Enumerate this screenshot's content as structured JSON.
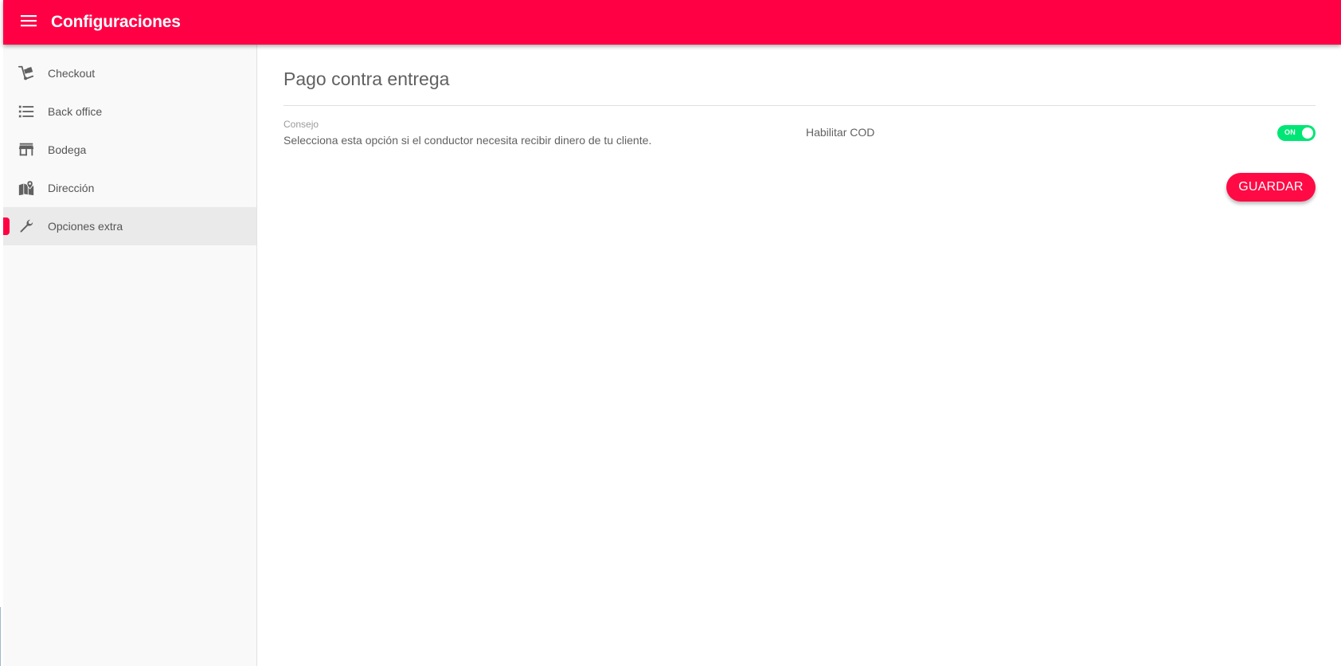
{
  "app_bar": {
    "title": "Configuraciones",
    "menu_icon": "menu-icon",
    "color": "#ff0045"
  },
  "sidebar": {
    "items": [
      {
        "label": "Checkout",
        "icon": "hand-truck-icon",
        "active": false
      },
      {
        "label": "Back office",
        "icon": "list-icon",
        "active": false
      },
      {
        "label": "Bodega",
        "icon": "store-icon",
        "active": false
      },
      {
        "label": "Dirección",
        "icon": "map-marker-icon",
        "active": false
      },
      {
        "label": "Opciones extra",
        "icon": "wrench-icon",
        "active": true
      }
    ]
  },
  "main": {
    "section_title": "Pago contra entrega",
    "hint_label": "Consejo",
    "hint_text": "Selecciona esta opción si el conductor necesita recibir dinero de tu cliente.",
    "cod_label": "Habilitar COD",
    "toggle": {
      "state_text": "ON",
      "checked": true,
      "color": "#00e676"
    },
    "save_label": "GUARDAR"
  }
}
